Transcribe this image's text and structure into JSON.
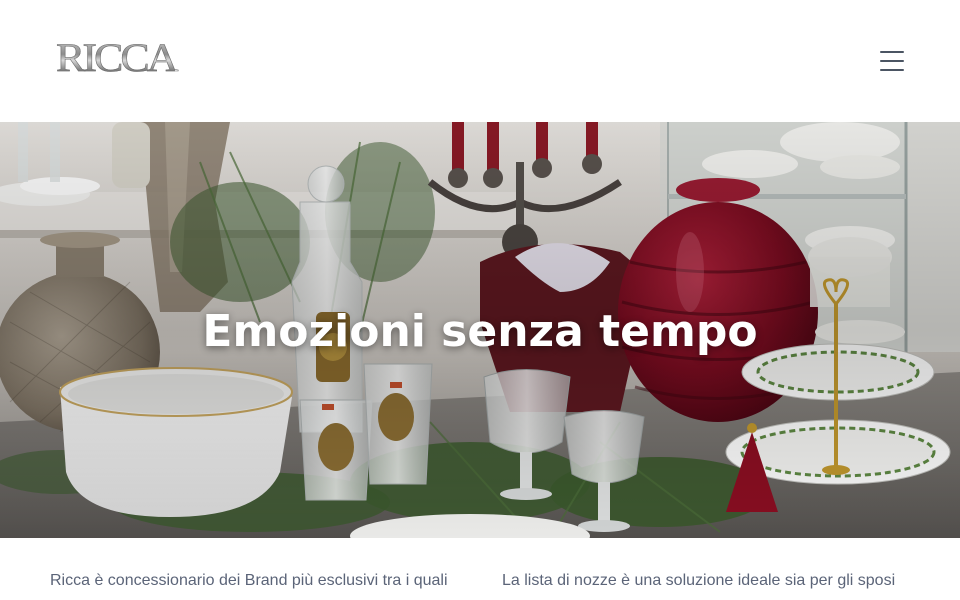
{
  "header": {
    "logo_text": "RICCA",
    "menu_icon": "hamburger-menu-icon"
  },
  "hero": {
    "title": "Emozioni senza tempo"
  },
  "intro": {
    "left_text": "Ricca è concessionario dei Brand più esclusivi tra i quali",
    "right_text": "La lista di nozze è una soluzione ideale sia per gli sposi"
  },
  "colors": {
    "text_muted": "#5b6478",
    "menu_icon": "#4b5563",
    "hero_title": "#ffffff"
  }
}
